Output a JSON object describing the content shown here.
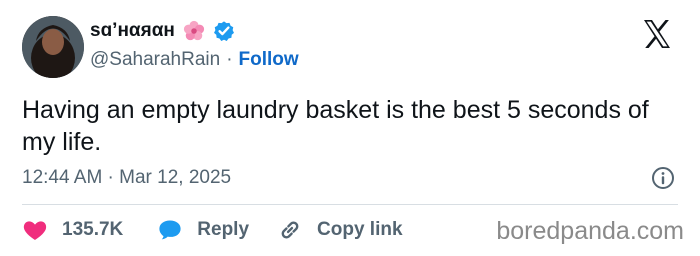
{
  "author": {
    "display_name": "sɑ’нαяαн",
    "handle": "@SaharahRain",
    "separator": "·",
    "follow_label": "Follow",
    "flower_emoji_icon": "hibiscus-emoji",
    "verified_icon": "verified-badge-icon"
  },
  "tweet": {
    "text": "Having an empty laundry basket is the best 5 seconds of my life.",
    "timestamp": "12:44 AM · Mar 12, 2025"
  },
  "actions": {
    "likes": "135.7K",
    "reply_label": "Reply",
    "copy_link_label": "Copy link"
  },
  "watermark": "boredpanda.com",
  "colors": {
    "text": "#0f1419",
    "muted": "#536471",
    "follow": "#0f69c9",
    "like": "#f02d7d",
    "reply": "#1d9bf0",
    "verified": "#1d9bf0"
  }
}
